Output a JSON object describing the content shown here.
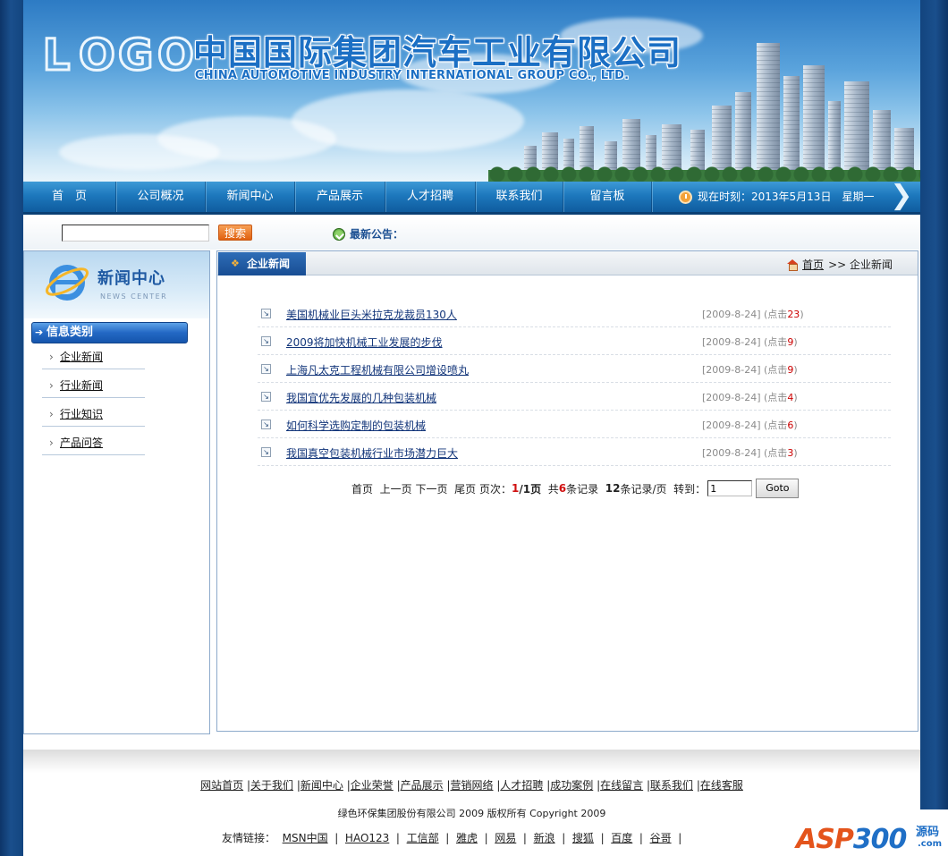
{
  "header": {
    "logo_text": "LOGO",
    "company_cn": "中国国际集团汽车工业有限公司",
    "company_en": "CHINA AUTOMOTIVE INDUSTRY INTERNATIONAL GROUP CO., LTD."
  },
  "nav": {
    "items": [
      "首　页",
      "公司概况",
      "新闻中心",
      "产品展示",
      "人才招聘",
      "联系我们",
      "留言板"
    ],
    "time_text": "现在时刻：2013年5月13日　星期一"
  },
  "search": {
    "value": "",
    "button_label": "搜索",
    "notice_label": "最新公告："
  },
  "sidebar": {
    "title": "新闻中心",
    "subtitle": "NEWS CENTER",
    "category_label": "信息类别",
    "links": [
      "企业新闻",
      "行业新闻",
      "行业知识",
      "产品问答"
    ]
  },
  "main": {
    "tab_label": "企业新闻",
    "breadcrumb_home": "首页",
    "breadcrumb_current": ">> 企业新闻",
    "news": [
      {
        "title": "美国机械业巨头米拉克龙裁员130人",
        "date": "[2009-8-24] (点击",
        "hits": "23",
        "close": ")"
      },
      {
        "title": "2009将加快机械工业发展的步伐",
        "date": "[2009-8-24] (点击",
        "hits": "9",
        "close": ")"
      },
      {
        "title": "上海凡太克工程机械有限公司增设喷丸",
        "date": "[2009-8-24] (点击",
        "hits": "9",
        "close": ")"
      },
      {
        "title": "我国宜优先发展的几种包装机械",
        "date": "[2009-8-24] (点击",
        "hits": "4",
        "close": ")"
      },
      {
        "title": "如何科学选购定制的包装机械",
        "date": "[2009-8-24] (点击",
        "hits": "6",
        "close": ")"
      },
      {
        "title": "我国真空包装机械行业市场潜力巨大",
        "date": "[2009-8-24] (点击",
        "hits": "3",
        "close": ")"
      }
    ],
    "pager": {
      "first": "首页",
      "prev": "上一页",
      "next": "下一页",
      "last": "尾页",
      "page_label": "页次：",
      "current_page": "1",
      "total_pages": "/1页",
      "total_prefix": "共",
      "total_records": "6",
      "total_suffix": "条记录",
      "per_page": "12",
      "per_page_suffix": "条记录/页",
      "goto_label": "转到：",
      "goto_value": "1",
      "goto_button": "Goto"
    }
  },
  "footer": {
    "links": [
      "网站首页",
      "关于我们",
      "新闻中心",
      "企业荣誉",
      "产品展示",
      "营销网络",
      "人才招聘",
      "成功案例",
      "在线留言",
      "联系我们",
      "在线客服"
    ],
    "copyright": "绿色环保集团股份有限公司  2009 版权所有  Copyright 2009",
    "friends_label": "友情链接：",
    "friends": [
      "MSN中国",
      "HAO123",
      "工信部",
      "雅虎",
      "网易",
      "新浪",
      "搜狐",
      "百度",
      "谷哥"
    ]
  },
  "watermark": {
    "brand_a": "ASP",
    "brand_b": "300",
    "brand_cn": "源码",
    "brand_com": ".com"
  }
}
